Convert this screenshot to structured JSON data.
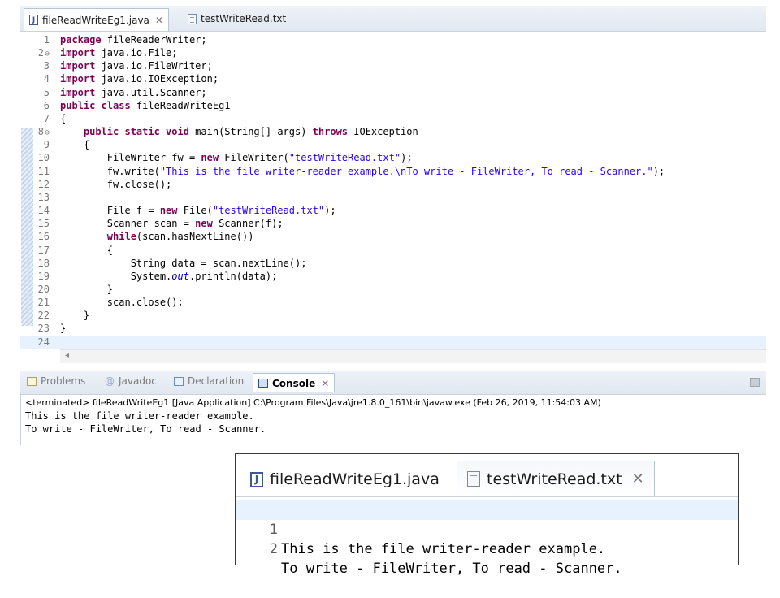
{
  "editor": {
    "tabs": [
      {
        "label": "fileReadWriteEg1.java",
        "icon": "java-file-icon",
        "active": true
      },
      {
        "label": "testWriteRead.txt",
        "icon": "text-file-icon",
        "active": false
      }
    ],
    "close_glyph": "✕",
    "lines": [
      "1",
      "2",
      "3",
      "4",
      "5",
      "6",
      "7",
      "8",
      "9",
      "10",
      "11",
      "12",
      "13",
      "14",
      "15",
      "16",
      "17",
      "18",
      "19",
      "20",
      "21",
      "22",
      "23",
      "24"
    ],
    "code": {
      "l1_kw": "package",
      "l1_rest": " fileReaderWriter;",
      "l2_kw": "import",
      "l2_rest": " java.io.File;",
      "l3_kw": "import",
      "l3_rest": " java.io.FileWriter;",
      "l4_kw": "import",
      "l4_rest": " java.io.IOException;",
      "l5_kw": "import",
      "l5_rest": " java.util.Scanner;",
      "l6_kw": "public class",
      "l6_rest": " fileReadWriteEg1",
      "l7": "{",
      "l8_kw1": "public static void",
      "l8_mid": " main(String[] args) ",
      "l8_kw2": "throws",
      "l8_rest": " IOException",
      "l9": "{",
      "l10_a": "FileWriter fw = ",
      "l10_kw": "new",
      "l10_b": " FileWriter(",
      "l10_s": "\"testWriteRead.txt\"",
      "l10_c": ");",
      "l11_a": "fw.write(",
      "l11_s": "\"This is the file writer-reader example.\\nTo write - FileWriter, To read - Scanner.\"",
      "l11_c": ");",
      "l12": "fw.close();",
      "l14_a": "File f = ",
      "l14_kw": "new",
      "l14_b": " File(",
      "l14_s": "\"testWriteRead.txt\"",
      "l14_c": ");",
      "l15_a": "Scanner scan = ",
      "l15_kw": "new",
      "l15_b": " Scanner(f);",
      "l16_kw": "while",
      "l16_rest": "(scan.hasNextLine())",
      "l17": "{",
      "l18": "String data = scan.nextLine();",
      "l19_a": "System.",
      "l19_f": "out",
      "l19_b": ".println(data);",
      "l20": "}",
      "l21": "scan.close();",
      "l22": "}",
      "l23": "}"
    },
    "hscroll_arrow": "◂"
  },
  "console": {
    "tabs": [
      {
        "label": "Problems",
        "active": false
      },
      {
        "label": "Javadoc",
        "active": false,
        "prefix": "@"
      },
      {
        "label": "Declaration",
        "active": false
      },
      {
        "label": "Console",
        "active": true
      }
    ],
    "close_glyph": "✕",
    "status": "<terminated> fileReadWriteEg1 [Java Application] C:\\Program Files\\Java\\jre1.8.0_161\\bin\\javaw.exe (Feb 26, 2019, 11:54:03 AM)",
    "output": [
      "This is the file writer-reader example.",
      "To write - FileWriter, To read - Scanner."
    ]
  },
  "txt_editor": {
    "tabs": [
      {
        "label": "fileReadWriteEg1.java",
        "active": false
      },
      {
        "label": "testWriteRead.txt",
        "active": true
      }
    ],
    "close_glyph": "✕",
    "lines": [
      {
        "num": "1",
        "text": "This is the file writer-reader example."
      },
      {
        "num": "2",
        "text": "To write - FileWriter, To read - Scanner."
      }
    ]
  }
}
